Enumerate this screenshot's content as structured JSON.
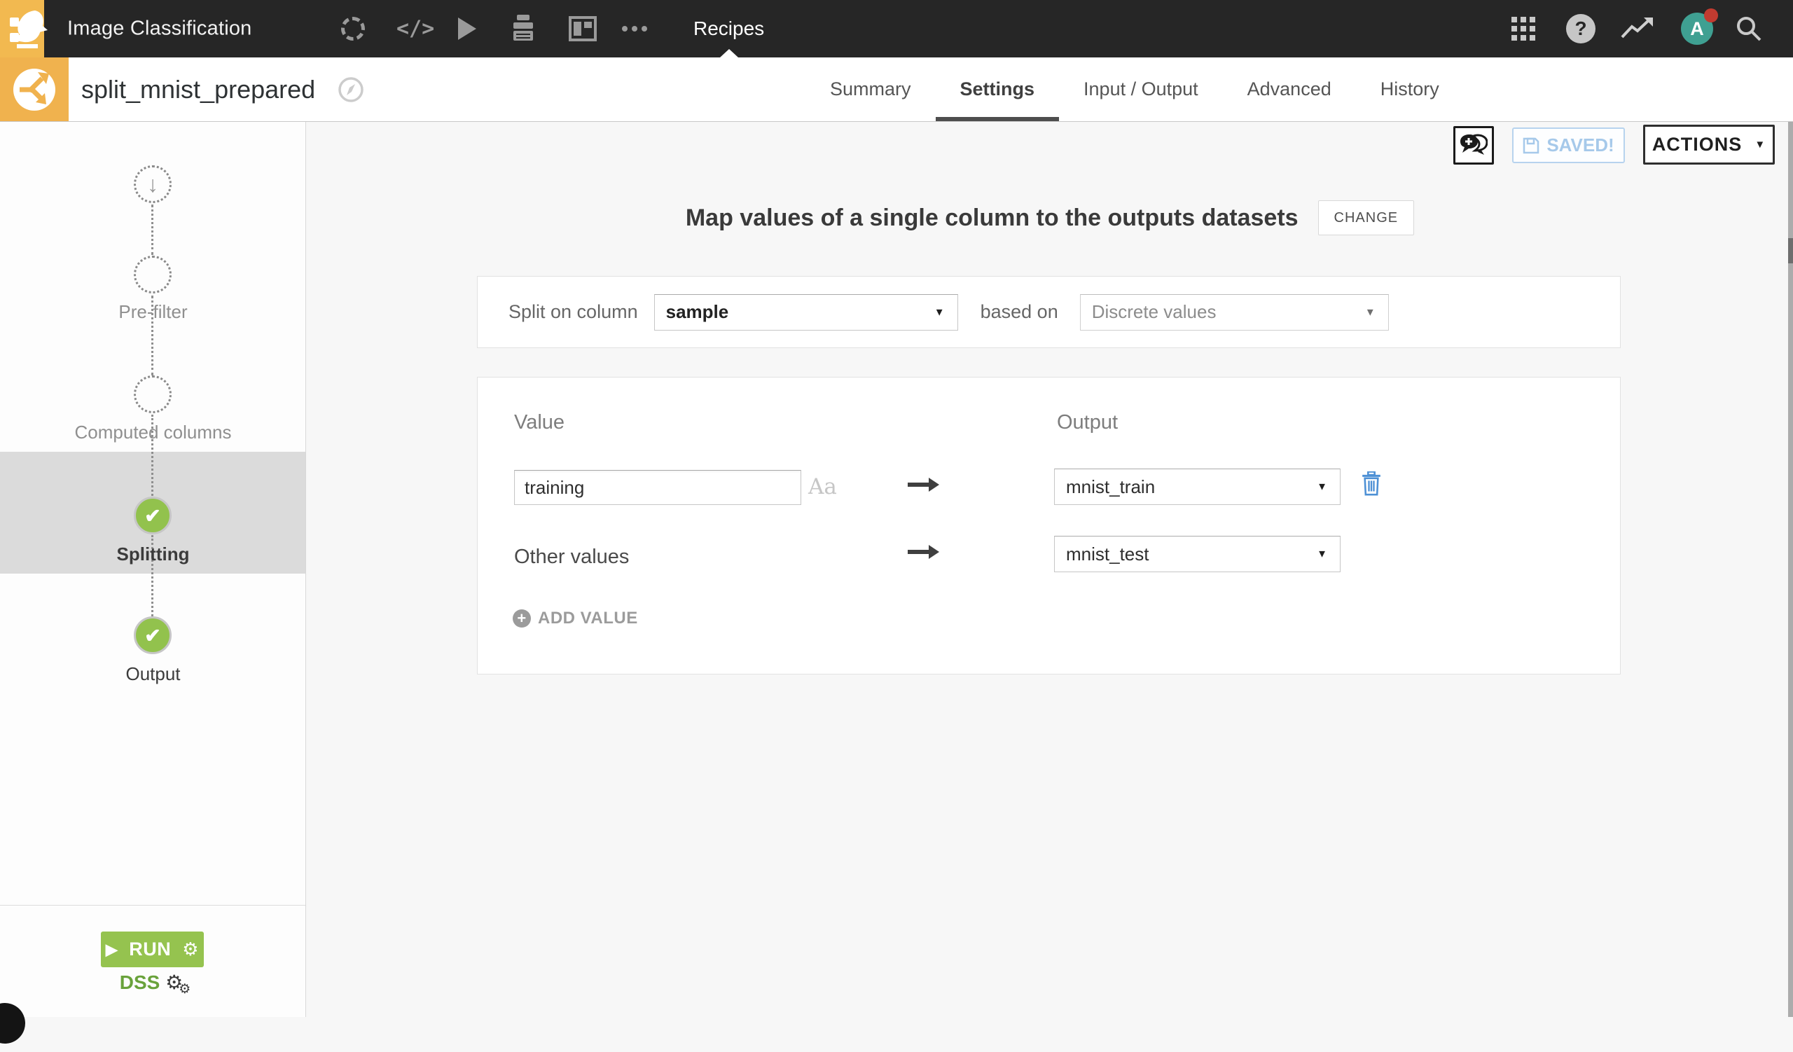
{
  "topbar": {
    "project_name": "Image Classification",
    "nav_current": "Recipes",
    "avatar_letter": "A"
  },
  "header": {
    "title": "split_mnist_prepared",
    "tabs": [
      {
        "label": "Summary"
      },
      {
        "label": "Settings"
      },
      {
        "label": "Input / Output"
      },
      {
        "label": "Advanced"
      },
      {
        "label": "History"
      }
    ],
    "saved_label": "SAVED!",
    "actions_label": "ACTIONS"
  },
  "sidebar": {
    "steps": [
      {
        "label": ""
      },
      {
        "label": "Pre-filter"
      },
      {
        "label": "Computed columns"
      },
      {
        "label": "Splitting"
      },
      {
        "label": "Output"
      }
    ],
    "run_label": "RUN",
    "engine_label": "DSS"
  },
  "main": {
    "heading": "Map values of a single column to the outputs datasets",
    "change_label": "CHANGE",
    "split_on_label": "Split on column",
    "split_column": "sample",
    "based_on_label": "based on",
    "based_on_value": "Discrete values",
    "value_header": "Value",
    "output_header": "Output",
    "row1": {
      "value": "training",
      "case_toggle": "Aa",
      "output": "mnist_train"
    },
    "row2": {
      "label": "Other values",
      "output": "mnist_test"
    },
    "add_value_label": "ADD VALUE"
  },
  "icons": {
    "play": "▶",
    "gear": "⚙",
    "down_arrow": "↓",
    "caret_down": "▼",
    "code": "</>",
    "question": "?",
    "check": "✔"
  },
  "colors": {
    "accent_orange": "#F0B24E",
    "success_green": "#95C34F",
    "action_blue": "#4D90D5",
    "saved_blue": "#A6C9EA",
    "avatar_teal": "#3FA092",
    "notification_red": "#C23B30"
  }
}
